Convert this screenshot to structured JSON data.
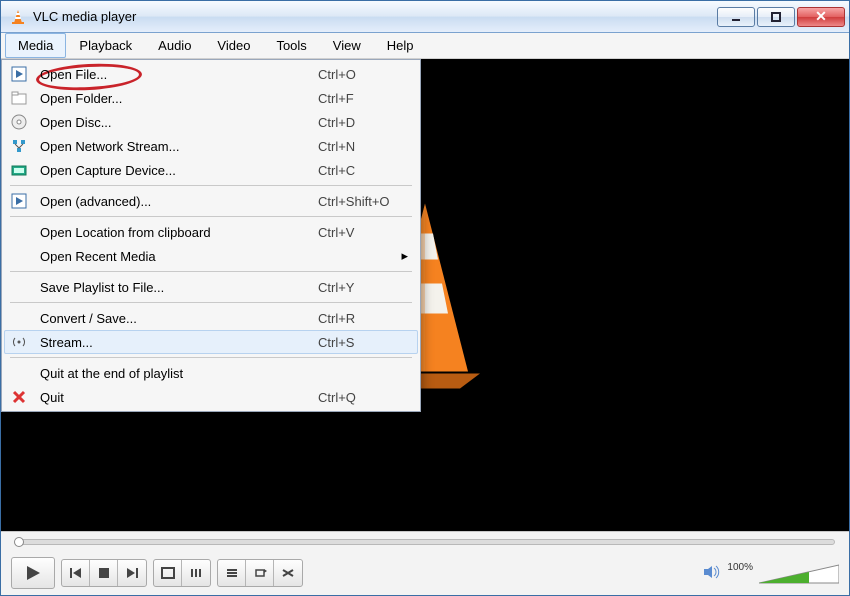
{
  "window": {
    "title": "VLC media player"
  },
  "menubar": {
    "items": [
      {
        "label": "Media",
        "active": true
      },
      {
        "label": "Playback"
      },
      {
        "label": "Audio"
      },
      {
        "label": "Video"
      },
      {
        "label": "Tools"
      },
      {
        "label": "View"
      },
      {
        "label": "Help"
      }
    ]
  },
  "media_menu": {
    "items": [
      {
        "icon": "play-file-icon",
        "label": "Open File...",
        "shortcut": "Ctrl+O",
        "circled": true
      },
      {
        "icon": "folder-icon",
        "label": "Open Folder...",
        "shortcut": "Ctrl+F"
      },
      {
        "icon": "disc-icon",
        "label": "Open Disc...",
        "shortcut": "Ctrl+D"
      },
      {
        "icon": "network-icon",
        "label": "Open Network Stream...",
        "shortcut": "Ctrl+N"
      },
      {
        "icon": "capture-icon",
        "label": "Open Capture Device...",
        "shortcut": "Ctrl+C"
      },
      {
        "sep": true
      },
      {
        "icon": "play-file-icon",
        "label": "Open (advanced)...",
        "shortcut": "Ctrl+Shift+O"
      },
      {
        "sep": true
      },
      {
        "label": "Open Location from clipboard",
        "shortcut": "Ctrl+V"
      },
      {
        "label": "Open Recent Media",
        "submenu": true
      },
      {
        "sep": true
      },
      {
        "label": "Save Playlist to File...",
        "shortcut": "Ctrl+Y"
      },
      {
        "sep": true
      },
      {
        "label": "Convert / Save...",
        "shortcut": "Ctrl+R"
      },
      {
        "icon": "stream-icon",
        "label": "Stream...",
        "shortcut": "Ctrl+S",
        "hover": true
      },
      {
        "sep": true
      },
      {
        "label": "Quit at the end of playlist"
      },
      {
        "icon": "quit-icon",
        "label": "Quit",
        "shortcut": "Ctrl+Q"
      }
    ]
  },
  "playback": {
    "volume_label": "100%"
  }
}
